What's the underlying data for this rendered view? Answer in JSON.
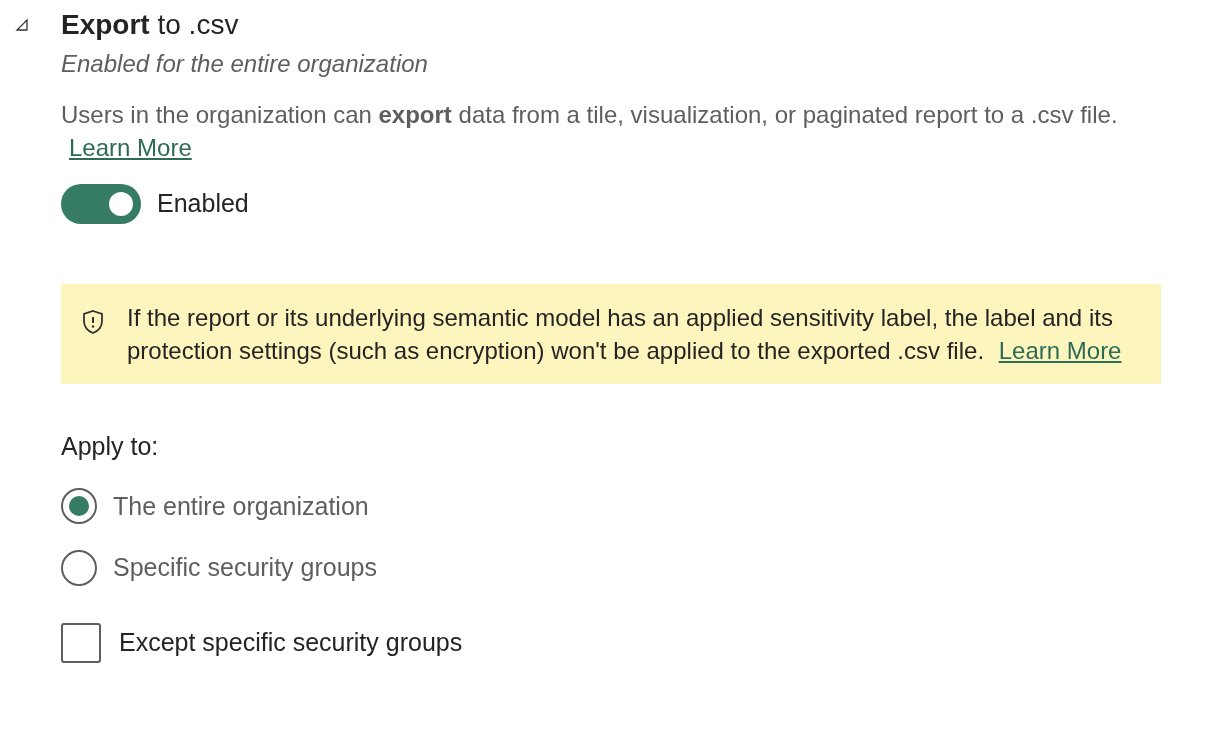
{
  "section": {
    "expanded": true,
    "title": "**Export** to .csv",
    "subtitle": "Enabled for the entire organization",
    "description": "Users in the organization can **export** data from a tile, visualization, or paginated report to a .csv file.",
    "description_link": "Learn More",
    "toggle": {
      "on": true,
      "label": "Enabled"
    },
    "notice": {
      "text": "If the report or its underlying semantic model has an applied sensitivity label, the label and its protection settings (such as encryption) won't be applied to the exported .csv file.",
      "link": "Learn More"
    },
    "apply_to": {
      "label": "Apply to:",
      "options": [
        {
          "label": "The entire organization",
          "selected": true
        },
        {
          "label": "Specific security groups",
          "selected": false
        }
      ]
    },
    "except": {
      "label": "Except specific security groups",
      "checked": false
    }
  }
}
